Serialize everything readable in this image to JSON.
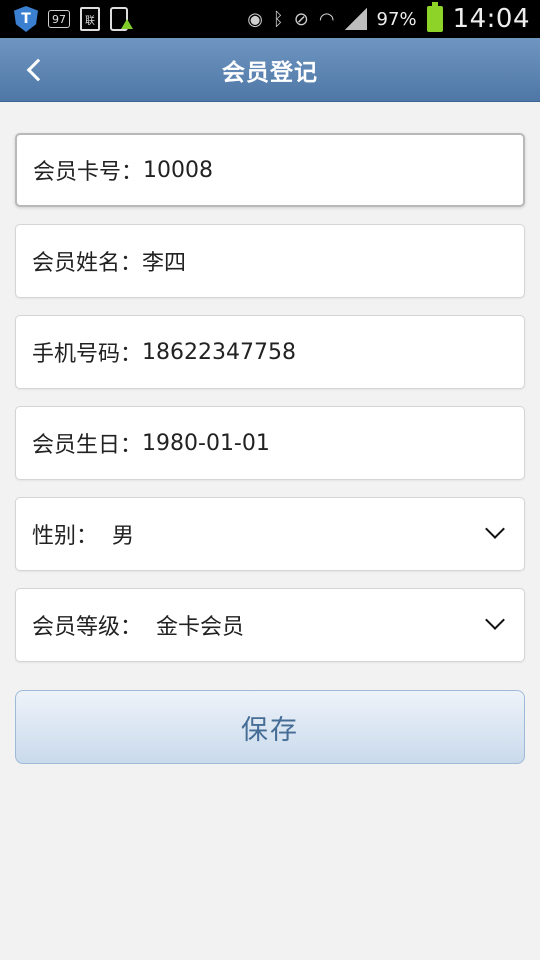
{
  "status_bar": {
    "shield_glyph": "T",
    "box_badge": "97",
    "doc_badge": "联",
    "battery_percent": "97%",
    "time": "14:04",
    "icons": [
      "shield-icon",
      "notification-97-icon",
      "doc-icon",
      "phone-upload-icon",
      "eye-icon",
      "bluetooth-icon",
      "mute-icon",
      "wifi-icon",
      "signal-icon",
      "battery-icon"
    ]
  },
  "header": {
    "title": "会员登记",
    "back_icon": "chevron-left-icon"
  },
  "form": {
    "card_number": {
      "label": "会员卡号：",
      "value": "10008"
    },
    "member_name": {
      "label": "会员姓名：",
      "value": "李四"
    },
    "phone": {
      "label": "手机号码：",
      "value": "18622347758"
    },
    "birthday": {
      "label": "会员生日：",
      "value": "1980-01-01"
    },
    "gender": {
      "label": "性别：",
      "value": "男"
    },
    "level": {
      "label": "会员等级：",
      "value": "金卡会员"
    }
  },
  "actions": {
    "save_label": "保存"
  },
  "colors": {
    "header_top": "#6f96c1",
    "header_bottom": "#4f77a6",
    "background": "#f2f2f2",
    "save_text": "#466d96",
    "battery": "#8ed428"
  }
}
